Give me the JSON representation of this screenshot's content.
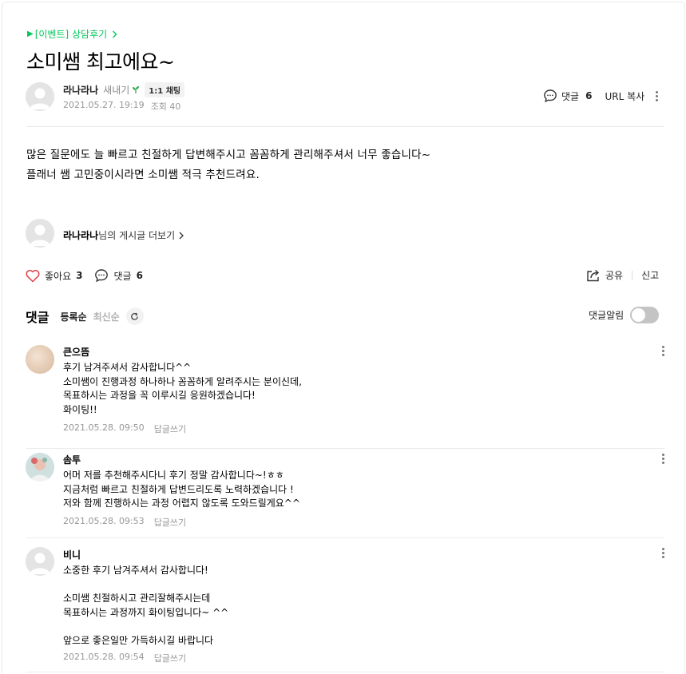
{
  "post": {
    "category": "[이벤트] 상담후기",
    "title": "소미쌤 최고에요~",
    "author": {
      "name": "라나라나",
      "grade": "새내기",
      "chat_badge": "1:1 채팅",
      "date": "2021.05.27. 19:19",
      "views": "조회 40"
    },
    "header_actions": {
      "comments_label": "댓글",
      "comments_count": "6",
      "url_copy": "URL 복사"
    },
    "body_lines": "많은 질문에도 늘 빠르고 친절하게 답변해주시고 꼼꼼하게 관리해주셔서 너무 좋습니다~\n플래너 쌤 고민중이시라면 소미쌤 적극 추천드려요.",
    "more_posts": {
      "name": "라나라나",
      "suffix": "님의 게시글 더보기"
    },
    "actions": {
      "like_label": "좋아요",
      "like_count": "3",
      "comment_label": "댓글",
      "comment_count": "6",
      "share_label": "공유",
      "report_label": "신고"
    }
  },
  "comments_section": {
    "title": "댓글",
    "sort_registered": "등록순",
    "sort_latest": "최신순",
    "alarm_label": "댓글알림",
    "comments": [
      {
        "author": "큰으뜸",
        "text": "후기 남겨주셔서 감사합니다^^\n소미쌤이 진행과정 하나하나 꼼꼼하게 알려주시는 분이신데,\n목표하시는 과정을 꼭 이루시길 응원하겠습니다!\n화이팅!!",
        "date": "2021.05.28. 09:50",
        "reply": "답글쓰기"
      },
      {
        "author": "솜투",
        "text": "어머 저를 추천해주시다니 후기 정말 감사합니다~!ㅎㅎ\n지금처럼 빠르고 친절하게 답변드리도록 노력하겠습니다 !\n저와 함께 진행하시는 과정 어렵지 않도록 도와드릴게요^^",
        "date": "2021.05.28. 09:53",
        "reply": "답글쓰기"
      },
      {
        "author": "비니",
        "text": "소중한 후기 남겨주셔서 감사합니다!\n\n소미쌤 친절하시고 관리잘해주시는데\n목표하시는 과정까지 화이팅입니다~ ^^\n\n앞으로 좋은일만 가득하시길 바랍니다",
        "date": "2021.05.28. 09:54",
        "reply": "답글쓰기"
      }
    ]
  },
  "colors": {
    "accent_green": "#03c75a",
    "like_red": "#e0424a",
    "meta_gray": "#979797"
  }
}
